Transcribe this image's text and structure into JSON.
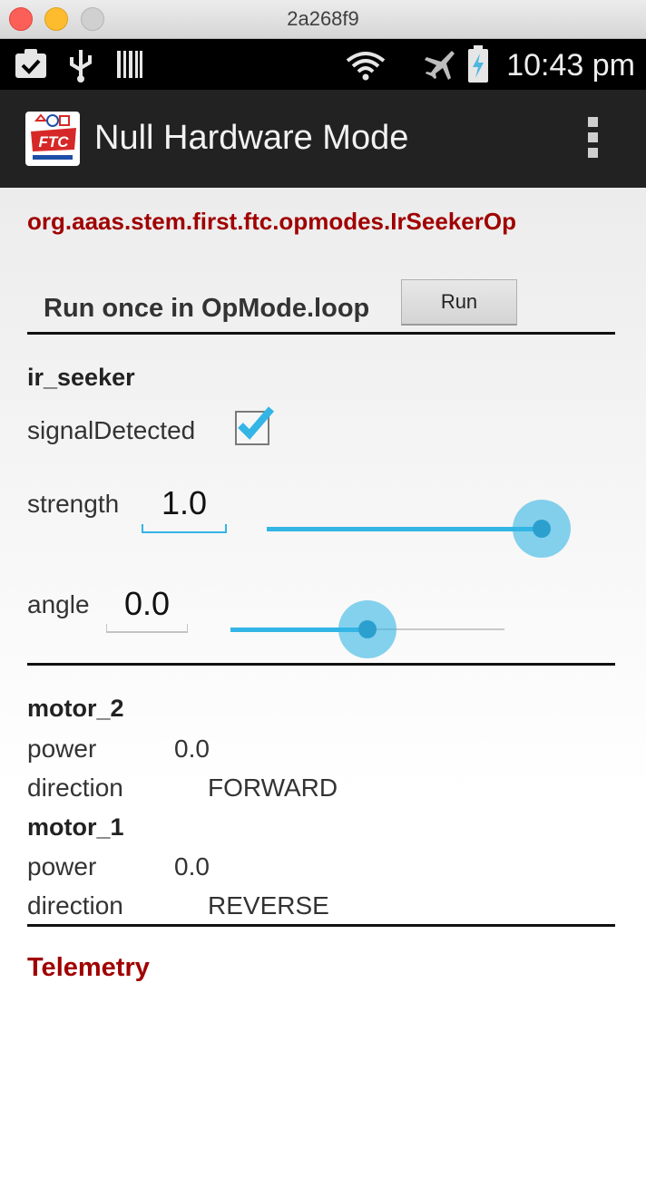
{
  "window": {
    "title": "2a268f9"
  },
  "status_bar": {
    "time": "10:43 pm",
    "icons": [
      "clipboard-check-icon",
      "usb-icon",
      "barcode-icon",
      "wifi-icon",
      "airplane-icon",
      "battery-charging-icon"
    ]
  },
  "action_bar": {
    "title": "Null Hardware Mode",
    "logo_text": "FTC",
    "overflow_icon": "overflow-menu-icon"
  },
  "opmode": {
    "name": "org.aaas.stem.first.ftc.opmodes.IrSeekerOp"
  },
  "run": {
    "label": "Run once in OpMode.loop",
    "button_label": "Run"
  },
  "ir_seeker": {
    "title": "ir_seeker",
    "signal_label": "signalDetected",
    "signal_checked": true,
    "strength_label": "strength",
    "strength_value": "1.0",
    "strength_slider": 1.0,
    "angle_label": "angle",
    "angle_value": "0.0",
    "angle_slider": 0.5
  },
  "motors": [
    {
      "title": "motor_2",
      "power_label": "power",
      "power_value": "0.0",
      "direction_label": "direction",
      "direction_value": "FORWARD"
    },
    {
      "title": "motor_1",
      "power_label": "power",
      "power_value": "0.0",
      "direction_label": "direction",
      "direction_value": "REVERSE"
    }
  ],
  "telemetry": {
    "title": "Telemetry"
  },
  "colors": {
    "accent": "#33b5e5",
    "heading_red": "#a00000"
  }
}
